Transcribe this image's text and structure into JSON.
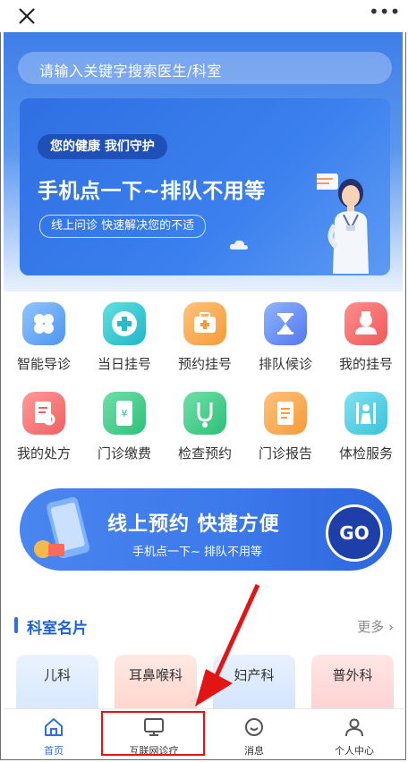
{
  "topbar": {
    "close_icon": "close-icon",
    "more_icon": "more-dots-icon"
  },
  "search": {
    "placeholder": "请输入关键字搜索医生/科室"
  },
  "banner": {
    "tag": "您的健康 我们守护",
    "headline": "手机点一下~排队不用等",
    "sub": "线上问诊 快速解决您的不适"
  },
  "services": [
    {
      "label": "智能导诊",
      "icon": "clover-icon"
    },
    {
      "label": "当日挂号",
      "icon": "plus-icon"
    },
    {
      "label": "预约挂号",
      "icon": "medkit-icon"
    },
    {
      "label": "排队候诊",
      "icon": "hourglass-icon"
    },
    {
      "label": "我的挂号",
      "icon": "nurse-icon"
    },
    {
      "label": "我的处方",
      "icon": "prescription-icon"
    },
    {
      "label": "门诊缴费",
      "icon": "payment-icon"
    },
    {
      "label": "检查预约",
      "icon": "stethoscope-icon"
    },
    {
      "label": "门诊报告",
      "icon": "report-icon"
    },
    {
      "label": "体检服务",
      "icon": "checkup-icon"
    }
  ],
  "promo": {
    "title": "线上预约 快捷方便",
    "sub": "手机点一下~ 排队不用等",
    "go": "GO"
  },
  "departments": {
    "title": "科室名片",
    "more": "更多",
    "items": [
      "儿科",
      "耳鼻喉科",
      "妇产科",
      "普外科"
    ]
  },
  "tabbar": [
    {
      "label": "首页",
      "icon": "home-icon"
    },
    {
      "label": "互联网诊疗",
      "icon": "monitor-icon"
    },
    {
      "label": "消息",
      "icon": "message-icon"
    },
    {
      "label": "个人中心",
      "icon": "user-icon"
    }
  ],
  "colors": {
    "accent": "#2f6fe2",
    "highlight": "#e21414"
  }
}
